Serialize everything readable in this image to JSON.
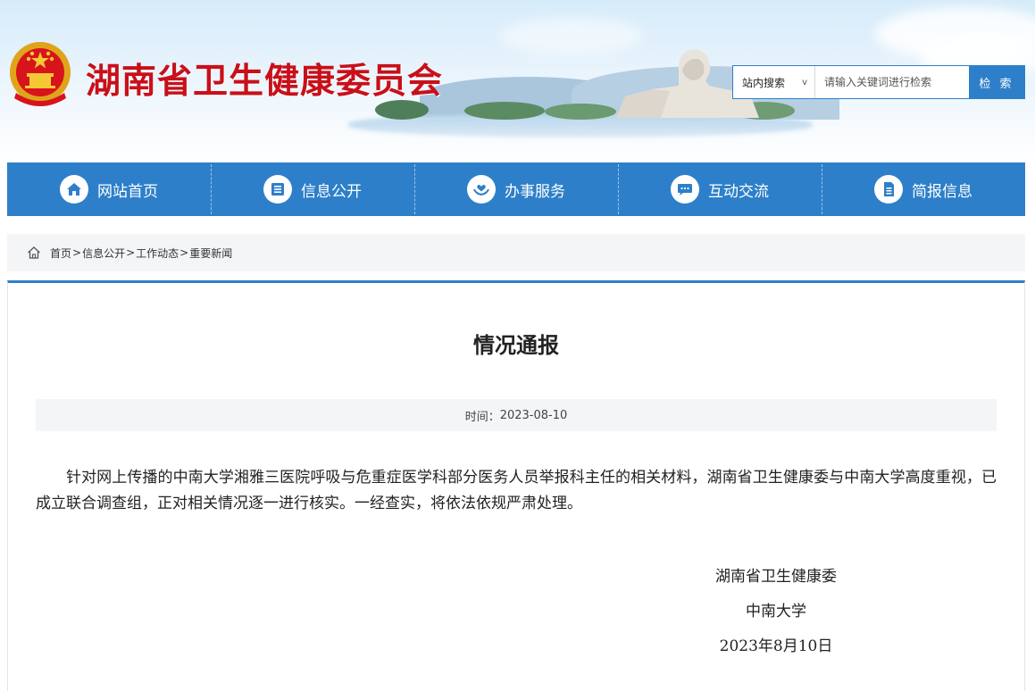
{
  "header": {
    "site_title": "湖南省卫生健康委员会",
    "emblem_icon": "national-emblem-icon"
  },
  "search": {
    "scope_label": "站内搜索",
    "scope_chevron": "v",
    "placeholder": "请输入关键词进行检索",
    "button_label": "检 索"
  },
  "nav": {
    "items": [
      {
        "label": "网站首页",
        "icon": "home-icon"
      },
      {
        "label": "信息公开",
        "icon": "document-list-icon"
      },
      {
        "label": "办事服务",
        "icon": "heart-hands-icon"
      },
      {
        "label": "互动交流",
        "icon": "chat-bubble-icon"
      },
      {
        "label": "简报信息",
        "icon": "briefing-document-icon"
      }
    ]
  },
  "breadcrumb": {
    "items": [
      "首页",
      "信息公开",
      "工作动态",
      "重要新闻"
    ],
    "separator": ">"
  },
  "article": {
    "title": "情况通报",
    "time_label": "时间：",
    "time_value": "2023-08-10",
    "body": "针对网上传播的中南大学湘雅三医院呼吸与危重症医学科部分医务人员举报科主任的相关材料，湖南省卫生健康委与中南大学高度重视，已成立联合调查组，正对相关情况逐一进行核实。一经查实，将依法依规严肃处理。",
    "signatures": [
      "湖南省卫生健康委",
      "中南大学",
      "2023年8月10日"
    ]
  },
  "colors": {
    "brand_blue": "#2e7fc9",
    "title_red": "#c8101a"
  }
}
